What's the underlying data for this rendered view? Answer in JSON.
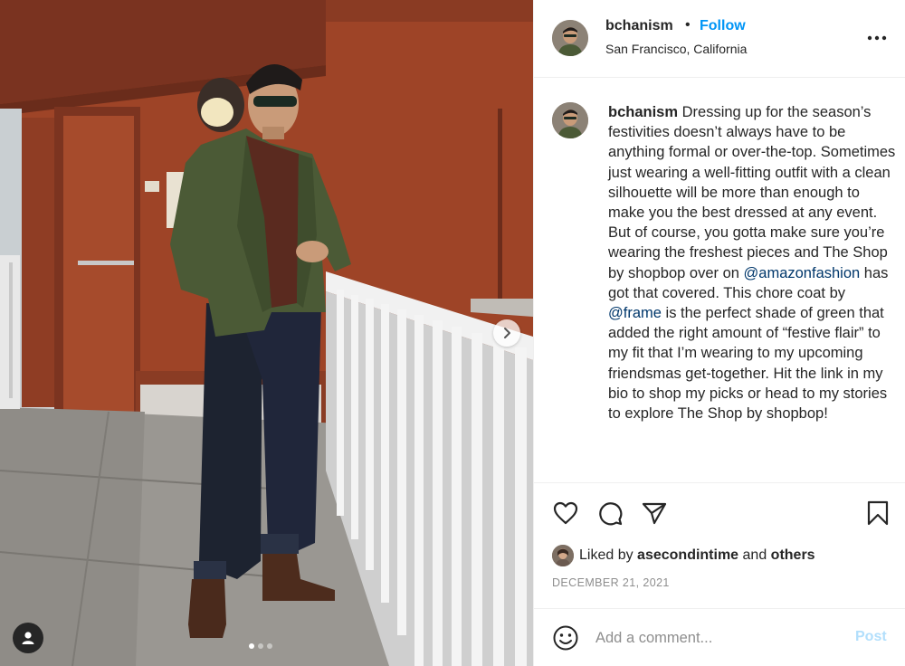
{
  "post": {
    "username": "bchanism",
    "separator": "•",
    "follow_label": "Follow",
    "location": "San Francisco, California",
    "more_icon": "more-options-icon"
  },
  "caption": {
    "username": "bchanism",
    "part1": " Dressing up for the season’s festivities doesn’t always have to be anything formal or over-the-top. Sometimes just wearing a well-fitting outfit with a clean silhouette will be more than enough to make you the best dressed at any event. But of course, you gotta make sure you’re wearing the freshest pieces and The Shop by shopbop over on ",
    "mention1": "@amazonfashion",
    "part2": " has got that covered. This chore coat by ",
    "mention2": "@frame",
    "part3": " is the perfect shade of green that added the right amount of “festive flair” to my fit that I’m wearing to my upcoming friendsmas get-together. Hit the link in my bio to shop my picks or head to my stories to explore The Shop by shopbop!"
  },
  "likes": {
    "prefix": "Liked by ",
    "user": "asecondintime",
    "middle": " and ",
    "others": "others"
  },
  "date": "DECEMBER 21, 2021",
  "comment_box": {
    "placeholder": "Add a comment...",
    "post_label": "Post"
  },
  "carousel": {
    "count": 3,
    "active_index": 0
  },
  "colors": {
    "accent": "#0095f6",
    "mention": "#00376b",
    "post_disabled": "#b2dffc",
    "muted": "#8e8e8e"
  }
}
